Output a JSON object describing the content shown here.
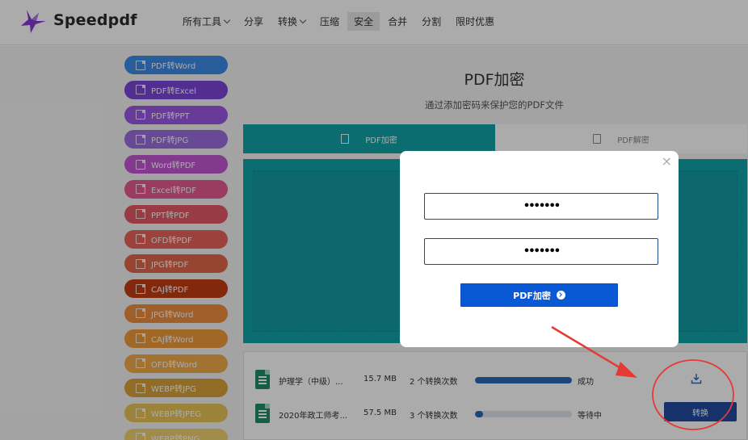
{
  "brand": {
    "name": "Speedpdf",
    "accent": "#8a3bd1"
  },
  "nav": [
    {
      "label": "所有工具",
      "dropdown": true,
      "active": false
    },
    {
      "label": "分享",
      "dropdown": false,
      "active": false
    },
    {
      "label": "转换",
      "dropdown": true,
      "active": false
    },
    {
      "label": "压缩",
      "dropdown": false,
      "active": false
    },
    {
      "label": "安全",
      "dropdown": false,
      "active": true
    },
    {
      "label": "合并",
      "dropdown": false,
      "active": false
    },
    {
      "label": "分割",
      "dropdown": false,
      "active": false
    },
    {
      "label": "限时优惠",
      "dropdown": false,
      "active": false
    }
  ],
  "sidebar": [
    {
      "label": "PDF转Word",
      "color": "#3d8be8"
    },
    {
      "label": "PDF转Excel",
      "color": "#7c45d8"
    },
    {
      "label": "PDF转PPT",
      "color": "#9b59e6"
    },
    {
      "label": "PDF转JPG",
      "color": "#9a6ee0"
    },
    {
      "label": "Word转PDF",
      "color": "#c357d4"
    },
    {
      "label": "Excel转PDF",
      "color": "#e45a8f"
    },
    {
      "label": "PPT转PDF",
      "color": "#e55863"
    },
    {
      "label": "OFD转PDF",
      "color": "#e9635a"
    },
    {
      "label": "JPG转PDF",
      "color": "#e2674a"
    },
    {
      "label": "CAJ转PDF",
      "color": "#c23d14"
    },
    {
      "label": "JPG转Word",
      "color": "#ef8c3e"
    },
    {
      "label": "CAJ转Word",
      "color": "#ef9a3a"
    },
    {
      "label": "OFD转Word",
      "color": "#f2aa48"
    },
    {
      "label": "WEBP转JPG",
      "color": "#d8a23b"
    },
    {
      "label": "WEBP转JPEG",
      "color": "#e8c557"
    },
    {
      "label": "WEBP转PNG",
      "color": "#f0d070"
    }
  ],
  "page": {
    "title": "PDF加密",
    "subtitle": "通过添加密码来保护您的PDF文件"
  },
  "tabs": [
    {
      "label": "PDF加密",
      "icon": "lock-file-icon",
      "active": true
    },
    {
      "label": "PDF解密",
      "icon": "unlock-file-icon",
      "active": false
    }
  ],
  "files": [
    {
      "name": "护理学（中级）...",
      "size": "15.7 MB",
      "count": "2 个转换次数",
      "progress": 1.0,
      "status": "成功",
      "action": "download"
    },
    {
      "name": "2020年政工师考...",
      "size": "57.5 MB",
      "count": "3 个转换次数",
      "progress": 0.08,
      "status": "等待中",
      "action": "转换"
    }
  ],
  "modal": {
    "close_label": "×",
    "password_value": "•••••••",
    "confirm_value": "•••••••",
    "submit_label": "PDF加密"
  },
  "colors": {
    "teal": "#11a3a8",
    "primary_blue": "#0a59d4",
    "annotation_red": "#e53935"
  }
}
